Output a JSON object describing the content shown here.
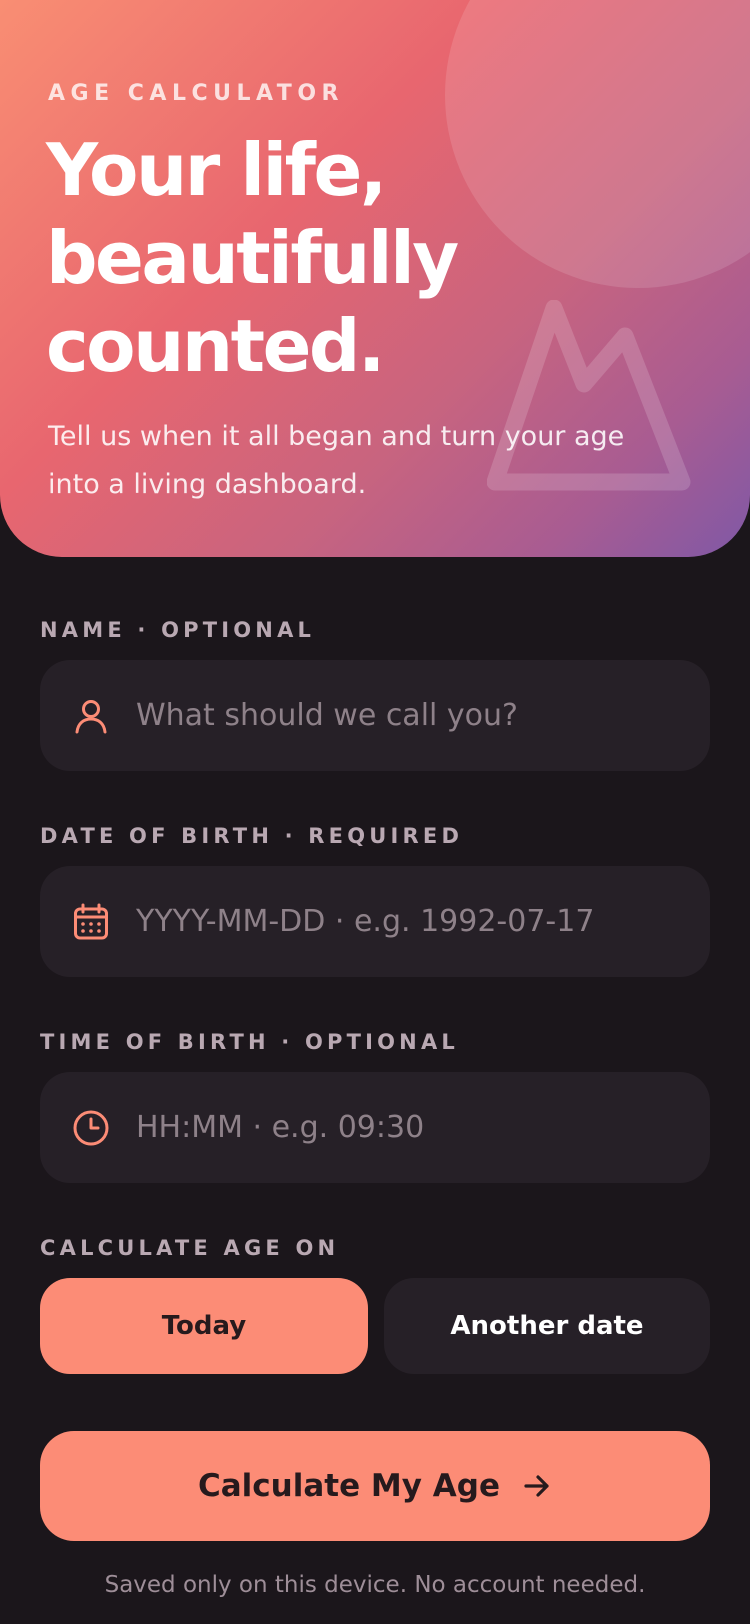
{
  "hero": {
    "eyebrow": "AGE CALCULATOR",
    "title": "Your life,\nbeautifully\ncounted.",
    "subtitle": "Tell us when it all began and turn your age into a living dashboard."
  },
  "form": {
    "name": {
      "label": "NAME · OPTIONAL",
      "placeholder": "What should we call you?",
      "icon": "person-icon"
    },
    "dob": {
      "label": "DATE OF BIRTH · REQUIRED",
      "placeholder": "YYYY-MM-DD · e.g. 1992-07-17",
      "icon": "calendar-icon"
    },
    "tob": {
      "label": "TIME OF BIRTH · OPTIONAL",
      "placeholder": "HH:MM · e.g. 09:30",
      "icon": "clock-icon"
    },
    "calc_on": {
      "label": "CALCULATE AGE ON",
      "options": [
        "Today",
        "Another date"
      ],
      "selected": "Today"
    }
  },
  "cta": {
    "label": "Calculate My Age",
    "icon": "arrow-right-icon"
  },
  "footnote": "Saved only on this device. No account needed.",
  "colors": {
    "background": "#1b161b",
    "accent": "#fc8c76",
    "field": "#262027",
    "label": "#b9a8b2",
    "hero_start": "#f98e73",
    "hero_end": "#7f58a6"
  }
}
